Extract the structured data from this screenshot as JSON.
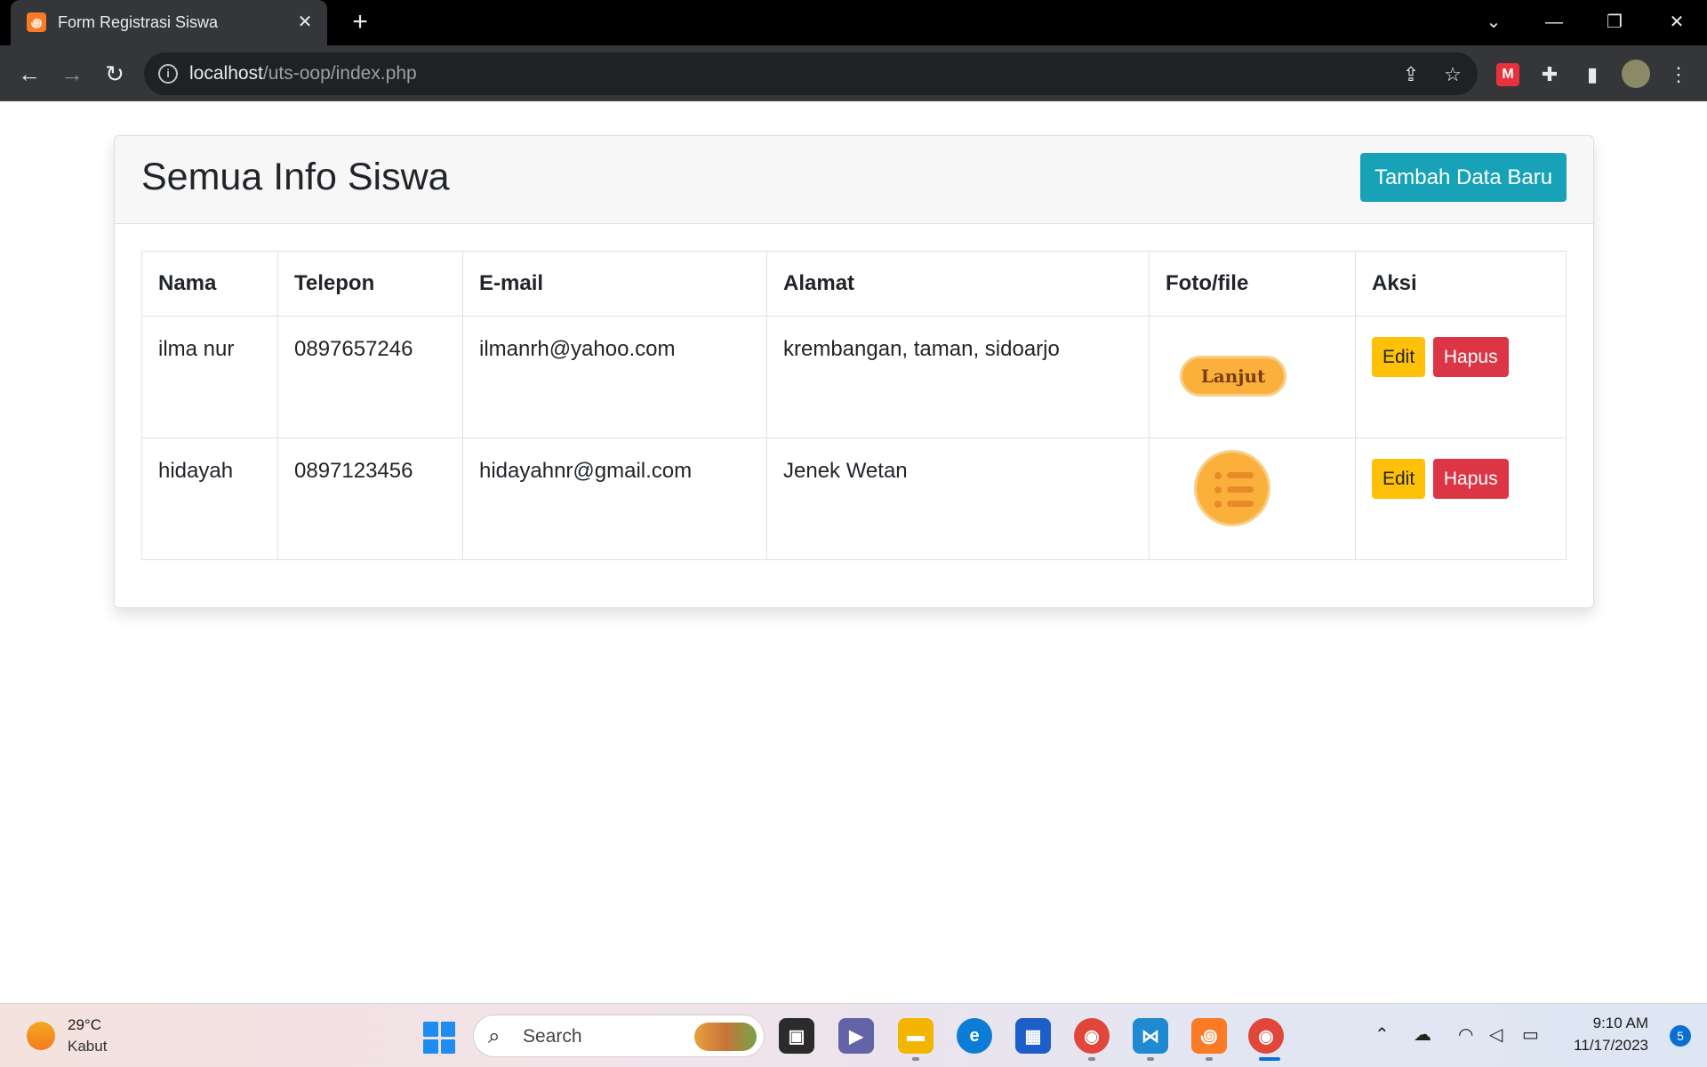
{
  "browser": {
    "tab_title": "Form Registrasi Siswa",
    "url_host": "localhost",
    "url_path": "/uts-oop/index.php"
  },
  "page": {
    "title": "Semua Info Siswa",
    "add_button": "Tambah Data Baru",
    "table": {
      "headers": [
        "Nama",
        "Telepon",
        "E-mail",
        "Alamat",
        "Foto/file",
        "Aksi"
      ],
      "rows": [
        {
          "nama": "ilma nur",
          "telepon": "0897657246",
          "email": "ilmanrh@yahoo.com",
          "alamat": "krembangan, taman, sidoarjo",
          "foto_text": "Lanjut",
          "edit": "Edit",
          "hapus": "Hapus"
        },
        {
          "nama": "hidayah",
          "telepon": "0897123456",
          "email": "hidayahnr@gmail.com",
          "alamat": "Jenek Wetan",
          "foto_text": "",
          "edit": "Edit",
          "hapus": "Hapus"
        }
      ]
    }
  },
  "taskbar": {
    "temperature": "29°C",
    "weather": "Kabut",
    "search_placeholder": "Search",
    "time": "9:10 AM",
    "date": "11/17/2023",
    "notification_count": "5"
  },
  "colors": {
    "accent": "#17a2b8",
    "edit": "#ffc107",
    "delete": "#dc3545"
  }
}
